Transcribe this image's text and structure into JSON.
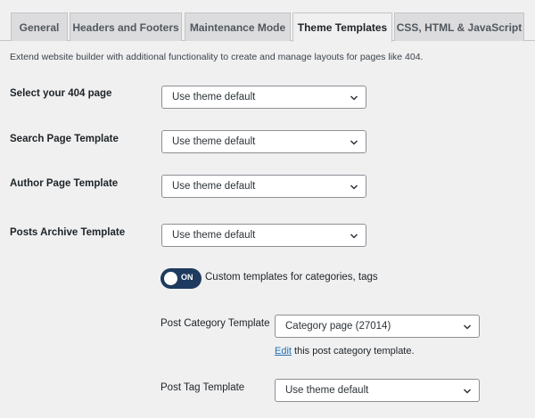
{
  "tabs": [
    {
      "label": "General",
      "active": false
    },
    {
      "label": "Headers and Footers",
      "active": false
    },
    {
      "label": "Maintenance Mode",
      "active": false
    },
    {
      "label": "Theme Templates",
      "active": true
    },
    {
      "label": "CSS, HTML & JavaScript",
      "active": false
    }
  ],
  "description": "Extend website builder with additional functionality to create and manage layouts for pages like 404.",
  "fields": {
    "page_404": {
      "label": "Select your 404 page",
      "value": "Use theme default"
    },
    "search": {
      "label": "Search Page Template",
      "value": "Use theme default"
    },
    "author": {
      "label": "Author Page Template",
      "value": "Use theme default"
    },
    "archive": {
      "label": "Posts Archive Template",
      "value": "Use theme default"
    }
  },
  "toggle": {
    "state_text": "ON",
    "enabled": true,
    "label": "Custom templates for categories, tags"
  },
  "post_category": {
    "label": "Post Category Template",
    "value": "Category page (27014)",
    "edit_link": "Edit",
    "edit_suffix": " this post category template."
  },
  "post_tag": {
    "label": "Post Tag Template",
    "value": "Use theme default"
  },
  "colors": {
    "accent": "#2271b1",
    "toggle_on": "#1e3a5f",
    "background": "#f0f0f1"
  }
}
